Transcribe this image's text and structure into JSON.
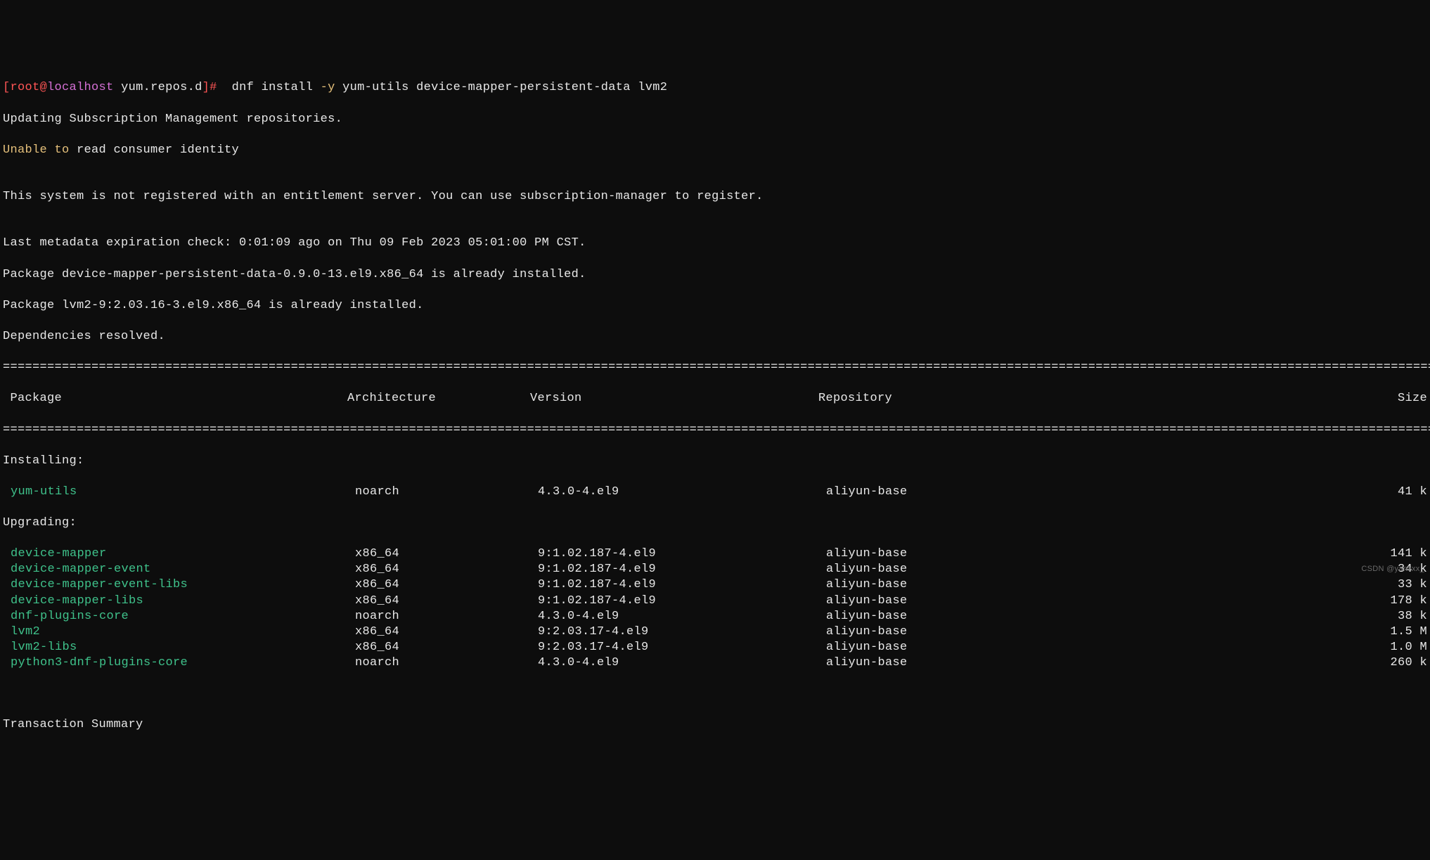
{
  "prompt": {
    "bracket_open": "[",
    "user": "root",
    "at": "@",
    "host": "localhost",
    "cwd": " yum.repos.d",
    "bracket_close": "]#  ",
    "cmd_part1": "dnf install ",
    "cmd_flag": "-y",
    "cmd_part2": " yum-utils device-mapper-persistent-data lvm2"
  },
  "lines": {
    "l1": "Updating Subscription Management repositories.",
    "l2a": "Unable to",
    "l2b": " read consumer identity",
    "l3": "",
    "l4": "This system is not registered with an entitlement server. You can use subscription-manager to register.",
    "l5": "",
    "l6": "Last metadata expiration check: 0:01:09 ago on Thu 09 Feb 2023 05:01:00 PM CST.",
    "l7": "Package device-mapper-persistent-data-0.9.0-13.el9.x86_64 is already installed.",
    "l8": "Package lvm2-9:2.03.16-3.el9.x86_64 is already installed.",
    "l9": "Dependencies resolved."
  },
  "divider": "========================================================================================================================================================================================================",
  "headers": {
    "pkg": " Package",
    "arch": "Architecture",
    "ver": "Version",
    "repo": "Repository",
    "size": "Size"
  },
  "sections": {
    "installing": "Installing:",
    "upgrading": "Upgrading:",
    "summary": "Transaction Summary"
  },
  "installing": [
    {
      "name": "yum-utils",
      "arch": "noarch",
      "ver": "4.3.0-4.el9",
      "repo": "aliyun-base",
      "size": "41 k"
    }
  ],
  "upgrading": [
    {
      "name": "device-mapper",
      "arch": "x86_64",
      "ver": "9:1.02.187-4.el9",
      "repo": "aliyun-base",
      "size": "141 k"
    },
    {
      "name": "device-mapper-event",
      "arch": "x86_64",
      "ver": "9:1.02.187-4.el9",
      "repo": "aliyun-base",
      "size": "34 k"
    },
    {
      "name": "device-mapper-event-libs",
      "arch": "x86_64",
      "ver": "9:1.02.187-4.el9",
      "repo": "aliyun-base",
      "size": "33 k"
    },
    {
      "name": "device-mapper-libs",
      "arch": "x86_64",
      "ver": "9:1.02.187-4.el9",
      "repo": "aliyun-base",
      "size": "178 k"
    },
    {
      "name": "dnf-plugins-core",
      "arch": "noarch",
      "ver": "4.3.0-4.el9",
      "repo": "aliyun-base",
      "size": "38 k"
    },
    {
      "name": "lvm2",
      "arch": "x86_64",
      "ver": "9:2.03.17-4.el9",
      "repo": "aliyun-base",
      "size": "1.5 M"
    },
    {
      "name": "lvm2-libs",
      "arch": "x86_64",
      "ver": "9:2.03.17-4.el9",
      "repo": "aliyun-base",
      "size": "1.0 M"
    },
    {
      "name": "python3-dnf-plugins-core",
      "arch": "noarch",
      "ver": "4.3.0-4.el9",
      "repo": "aliyun-base",
      "size": "260 k"
    }
  ],
  "watermark": "CSDN @yanxxx_"
}
